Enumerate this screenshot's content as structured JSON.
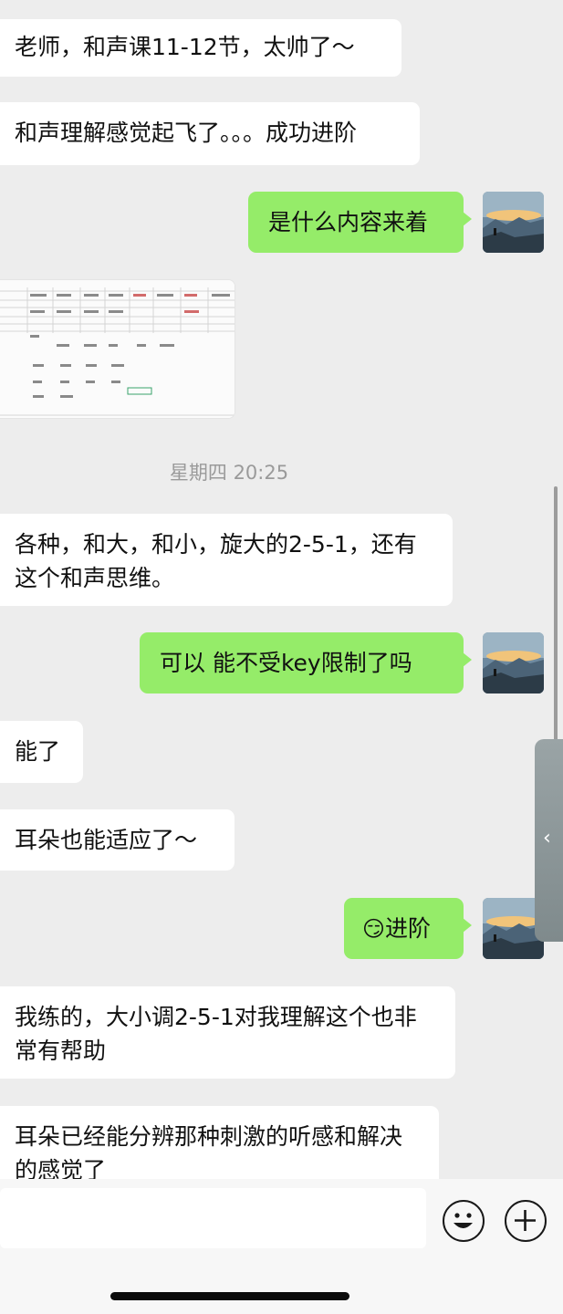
{
  "messages": [
    {
      "side": "left",
      "text": "老师，和声课11-12节，太帅了～"
    },
    {
      "side": "left",
      "text": "和声理解感觉起飞了。。。成功进阶"
    },
    {
      "side": "right",
      "text": "是什么内容来着"
    },
    {
      "side": "left",
      "type": "image",
      "alt": "chord-table-screenshot"
    },
    {
      "type": "timestamp",
      "text": "星期四 20:25"
    },
    {
      "side": "left",
      "text": "各种，和大，和小，旋大的2-5-1，还有这个和声思维。"
    },
    {
      "side": "right",
      "text": "可以 能不受key限制了吗"
    },
    {
      "side": "left",
      "text": "能了"
    },
    {
      "side": "left",
      "text": "耳朵也能适应了～"
    },
    {
      "side": "right",
      "emoji": "😏",
      "text": "进阶"
    },
    {
      "side": "left",
      "text": "我练的，大小调2-5-1对我理解这个也非常有帮助"
    },
    {
      "side": "left",
      "text": "耳朵已经能分辨那种刺激的听感和解决的感觉了"
    }
  ],
  "colors": {
    "background": "#ededed",
    "sent_bubble": "#95ec69",
    "received_bubble": "#ffffff",
    "timestamp": "#9a9a9a"
  },
  "icons": {
    "emoji_button": "emoji-face-icon",
    "more_button": "plus-icon",
    "side_handle": "chevron-left-icon"
  }
}
